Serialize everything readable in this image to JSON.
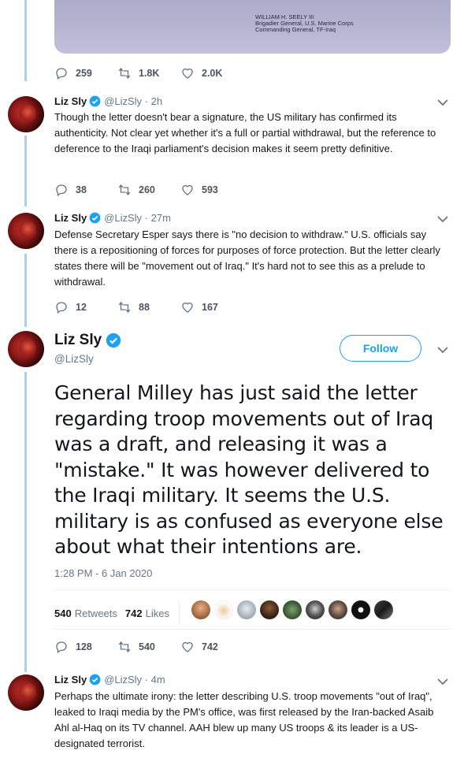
{
  "attached_image": {
    "signature_lines": [
      "WILLIAM H. SEELY III",
      "Brigadier General, U.S. Marine Corps",
      "Commanding General, TF-Iraq"
    ]
  },
  "tweet0": {
    "replies": "259",
    "retweets": "1.8K",
    "likes": "2.0K"
  },
  "tweet1": {
    "name": "Liz Sly",
    "handle": "@LizSly",
    "time": "2h",
    "text": "Though the letter doesn't bear a signature, the US military has confirmed its authenticity. Not clear yet whether it's a full or partial withdrawal, but the reference to deference to the Iraqi parliament's decision makes it seem pretty definitive.",
    "replies": "38",
    "retweets": "260",
    "likes": "593"
  },
  "tweet2": {
    "name": "Liz Sly",
    "handle": "@LizSly",
    "time": "27m",
    "text": "Defense Secretary Esper says there is \"no decision to withdraw.\" U.S. officials say there is a repositioning of forces for purposes of force protection.  But the letter clearly states there will be \"movement out of Iraq.\" It's hard not to see this as a prelude to withdrawal.",
    "replies": "12",
    "retweets": "88",
    "likes": "167"
  },
  "main_tweet": {
    "name": "Liz Sly",
    "handle": "@LizSly",
    "follow_label": "Follow",
    "text": "General Milley has just said the letter regarding troop movements out of Iraq was a draft, and releasing it was a \"mistake.\" It was however delivered to the Iraqi military. It seems the U.S. military is as confused as everyone else about what their intentions are.",
    "timestamp": "1:28 PM - 6 Jan 2020",
    "retweets_count": "540",
    "retweets_label": "Retweets",
    "likes_count": "742",
    "likes_label": "Likes",
    "replies": "128",
    "retweets": "540",
    "likes": "742"
  },
  "tweet4": {
    "name": "Liz Sly",
    "handle": "@LizSly",
    "time": "4m",
    "text": "Perhaps the ultimate irony: the letter describing U.S. troop movements \"out of Iraq\", leaked to Iraqi media by the PM's office, was first released by the Iran-backed Asaib Ahl al-Haq on its TV channel. AAH blew up many US troops & its leader is a US-designated terrorist."
  },
  "colors": {
    "accent": "#1da1f2",
    "thread_line": "#aecbf0",
    "muted": "#657786"
  }
}
